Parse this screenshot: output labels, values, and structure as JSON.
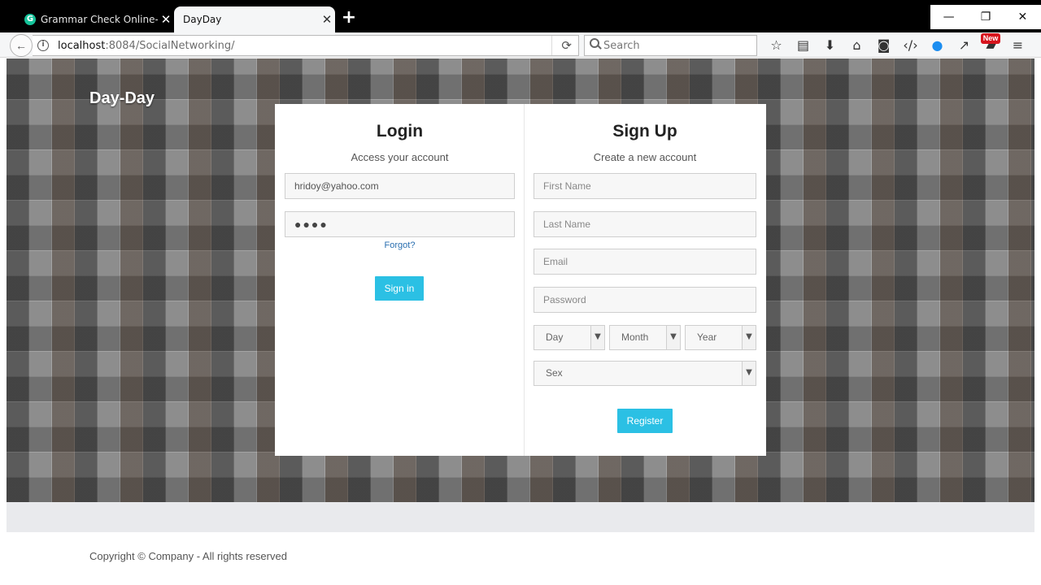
{
  "browser": {
    "tabs": [
      {
        "title": "Grammar Check Online- It's Free",
        "active": false
      },
      {
        "title": "DayDay",
        "active": true
      }
    ],
    "url_host": "localhost",
    "url_port_path": ":8084/SocialNetworking/",
    "search_placeholder": "Search",
    "new_badge": "New",
    "icons": [
      "bookmark-star-icon",
      "reading-list-icon",
      "download-icon",
      "home-icon",
      "pocket-icon",
      "developer-icon",
      "messenger-icon",
      "pin-icon",
      "chat-icon",
      "menu-icon"
    ]
  },
  "site": {
    "brand": "Day-Day",
    "footer": "Copyright © Company - All rights reserved"
  },
  "login": {
    "title": "Login",
    "subtitle": "Access your account",
    "email_value": "hridoy@yahoo.com",
    "password_value": "●●●●",
    "forgot": "Forgot?",
    "submit": "Sign in"
  },
  "signup": {
    "title": "Sign Up",
    "subtitle": "Create a new account",
    "first_name_placeholder": "First Name",
    "last_name_placeholder": "Last Name",
    "email_placeholder": "Email",
    "password_placeholder": "Password",
    "day": "Day",
    "month": "Month",
    "year": "Year",
    "sex": "Sex",
    "submit": "Register"
  },
  "colors": {
    "accent": "#2bc0e4",
    "link": "#2a6fb0"
  }
}
